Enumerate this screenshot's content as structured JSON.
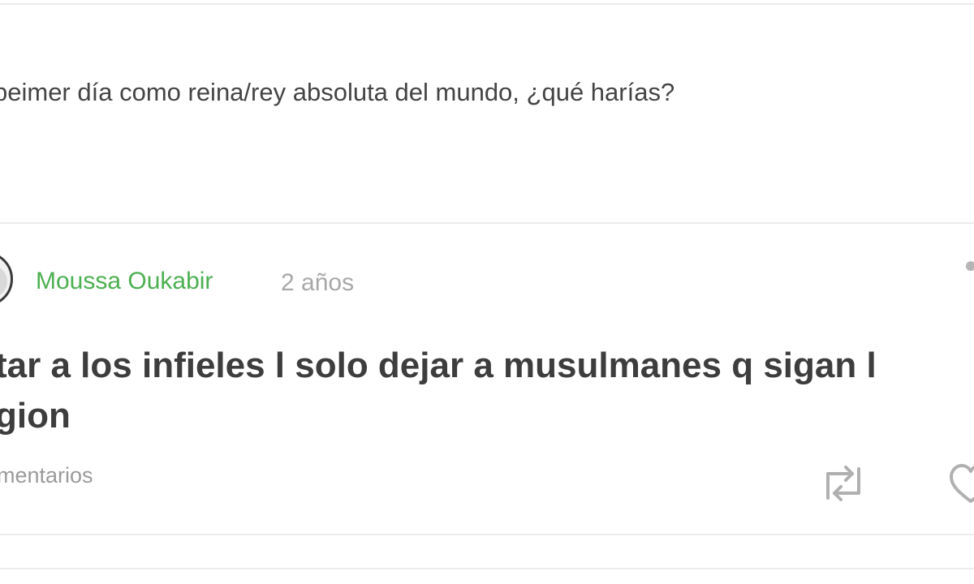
{
  "question": {
    "text": "peimer día como reina/rey absoluta del mundo, ¿qué harías?"
  },
  "answer": {
    "author": "Moussa Oukabir",
    "time": "2 años",
    "text_line1": "tar a los infieles l solo dejar a musulmanes q sigan l",
    "text_line2": "gion"
  },
  "actions": {
    "comments_label": "mentarios",
    "repost_icon": "repost-icon",
    "like_icon": "heart-icon",
    "more_icon": "more-icon"
  },
  "colors": {
    "author_green": "#4caf50",
    "icon_gray": "#b0b0b0"
  }
}
